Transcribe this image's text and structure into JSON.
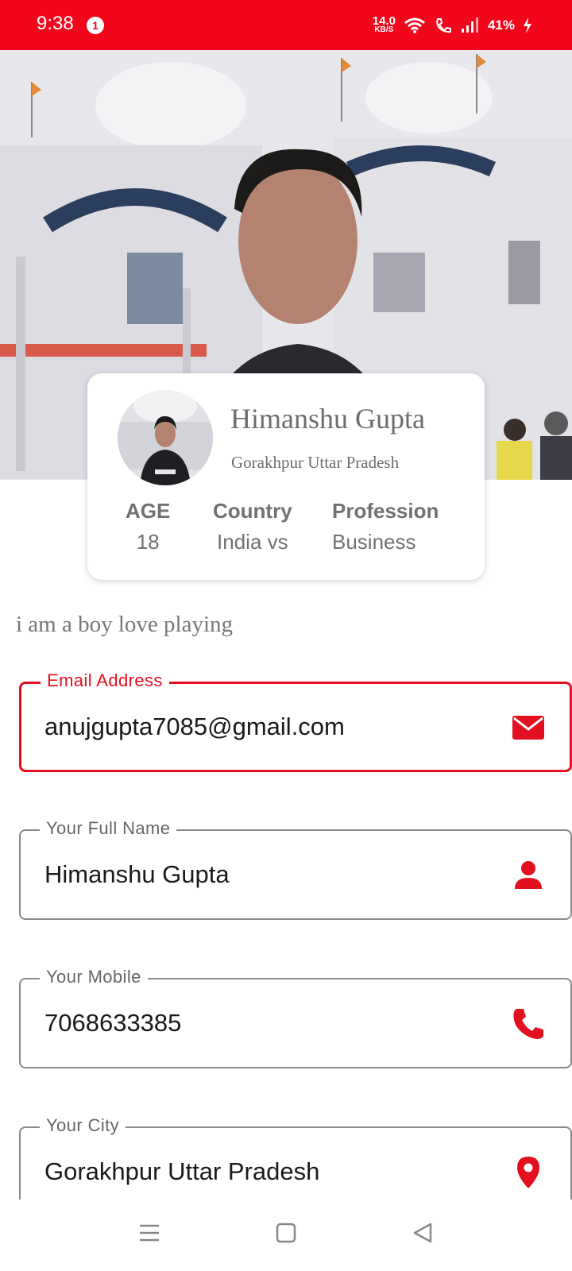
{
  "status_bar": {
    "time": "9:38",
    "notification_count": "1",
    "net_speed_value": "14.0",
    "net_speed_unit": "KB/S",
    "battery": "41%"
  },
  "profile": {
    "name": "Himanshu Gupta",
    "location": "Gorakhpur Uttar Pradesh",
    "stats": [
      {
        "label": "AGE",
        "value": "18"
      },
      {
        "label": "Country",
        "value": "India vs"
      },
      {
        "label": "Profession",
        "value": "Business"
      }
    ],
    "bio": "i am a boy love playing"
  },
  "form": {
    "email": {
      "label": "Email Address",
      "value": "anujgupta7085@gmail.com",
      "icon": "mail-icon"
    },
    "full_name": {
      "label": "Your Full Name",
      "value": "Himanshu Gupta",
      "icon": "person-icon"
    },
    "mobile": {
      "label": "Your Mobile",
      "value": "7068633385",
      "icon": "phone-icon"
    },
    "city": {
      "label": "Your City",
      "value": "Gorakhpur Uttar Pradesh",
      "icon": "location-pin-icon"
    }
  },
  "colors": {
    "accent": "#e3101f",
    "status_bar": "#f2061c",
    "muted_text": "#6d6d6d",
    "field_border": "#8a8a8a"
  },
  "nav_bar": {
    "icons": [
      "menu-icon",
      "home-icon",
      "back-icon"
    ]
  }
}
